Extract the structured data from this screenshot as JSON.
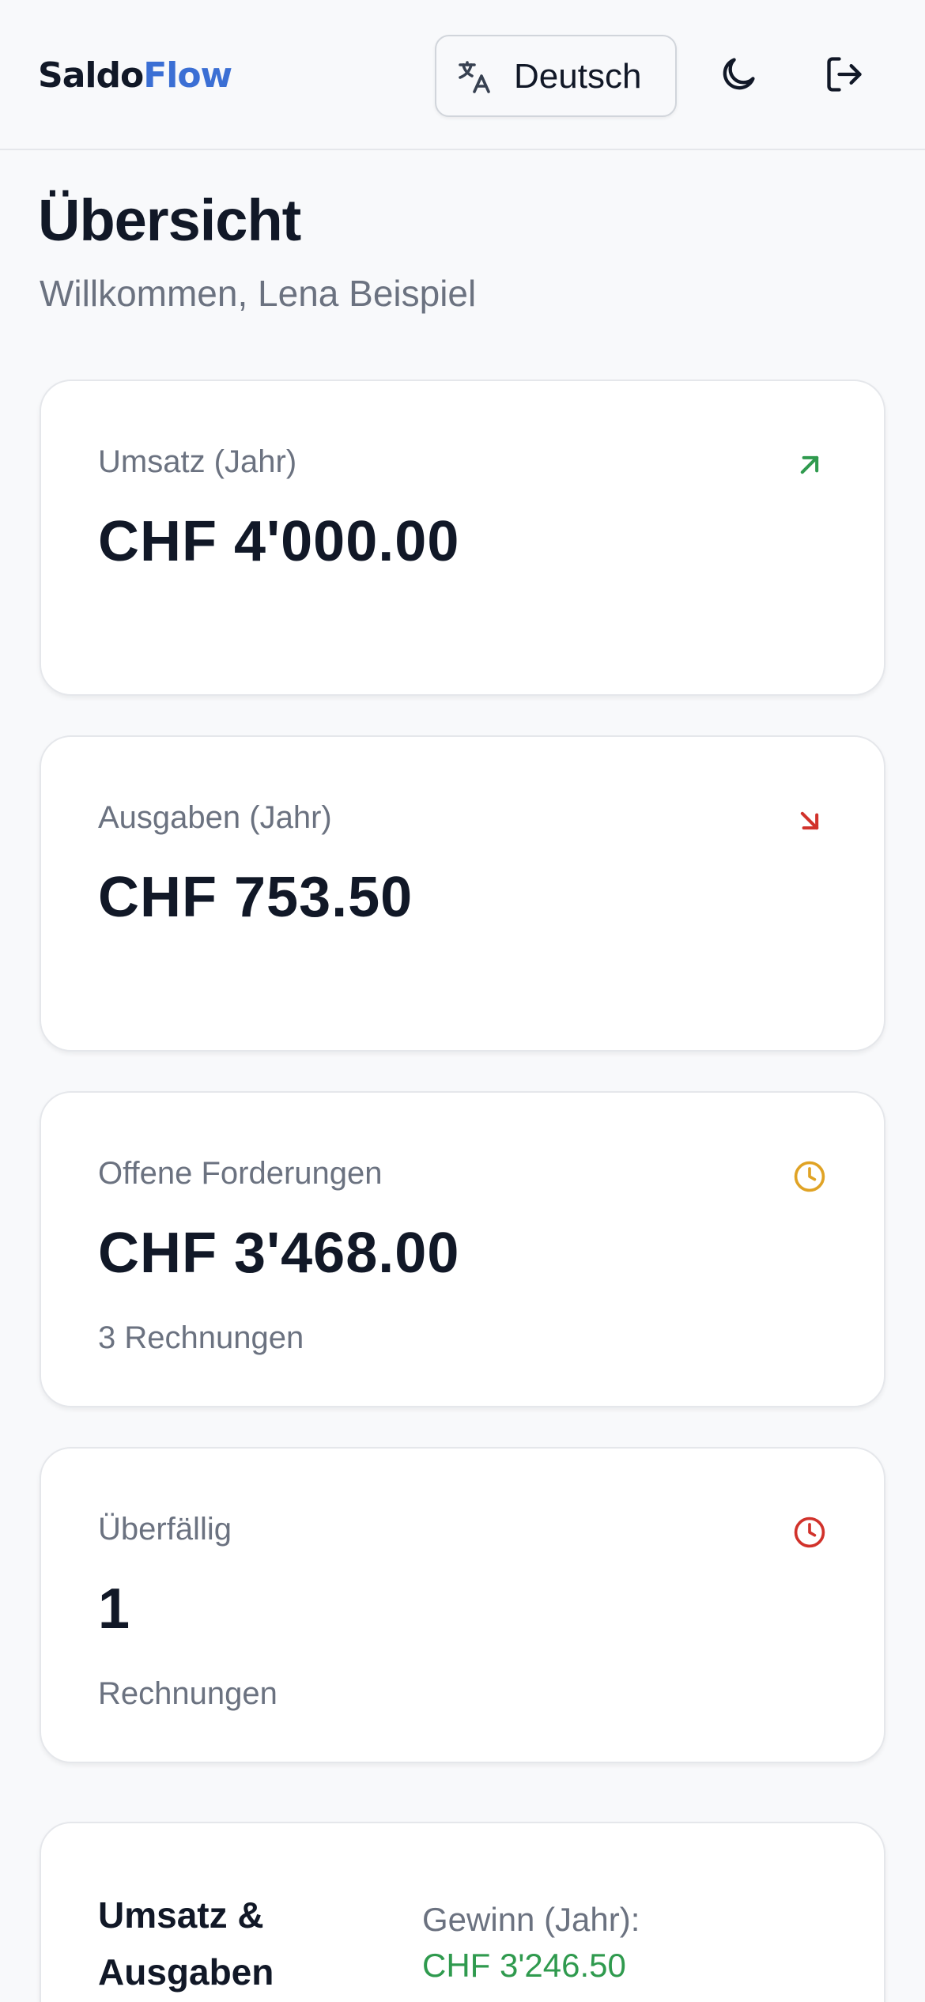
{
  "brand": {
    "part1": "Saldo",
    "part2": "Flow",
    "accent_color": "#3b6fd4"
  },
  "header": {
    "language_label": "Deutsch",
    "language_icon": "translate-icon",
    "theme_icon": "moon-icon",
    "logout_icon": "logout-icon"
  },
  "page": {
    "title": "Übersicht",
    "welcome": "Willkommen, Lena Beispiel"
  },
  "cards": [
    {
      "label": "Umsatz (Jahr)",
      "value": "CHF 4'000.00",
      "sub": "",
      "icon": "arrow-up-right-icon",
      "icon_color": "#2f9a4e"
    },
    {
      "label": "Ausgaben (Jahr)",
      "value": "CHF 753.50",
      "sub": "",
      "icon": "arrow-down-right-icon",
      "icon_color": "#d1322b"
    },
    {
      "label": "Offene Forderungen",
      "value": "CHF 3'468.00",
      "sub": "3 Rechnungen",
      "icon": "clock-icon",
      "icon_color": "#e0a325"
    },
    {
      "label": "Überfällig",
      "value": "1",
      "sub": "Rechnungen",
      "icon": "clock-icon",
      "icon_color": "#d1322b"
    }
  ],
  "summary": {
    "title": "Umsatz & Ausgaben",
    "profit_label": "Gewinn (Jahr):",
    "profit_value": "CHF 3'246.50",
    "profit_color": "#2f9a4e"
  }
}
